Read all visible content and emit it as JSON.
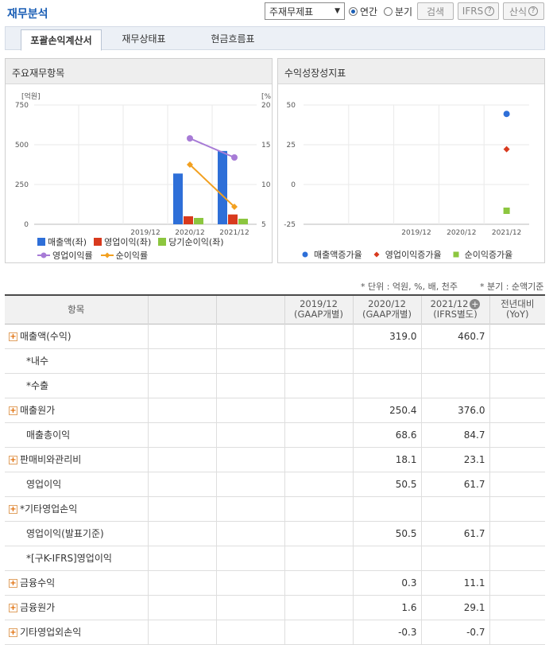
{
  "header": {
    "title": "재무분석",
    "select_value": "주재무제표",
    "radio_annual": "연간",
    "radio_quarter": "분기",
    "search_button": "검색",
    "ifrs_button": "IFRS",
    "formula_button": "산식"
  },
  "tabs": [
    "포괄손익계산서",
    "재무상태표",
    "현금흐름표"
  ],
  "chart_left": {
    "title": "주요재무항목",
    "y_left_unit": "[억원]",
    "y_right_unit": "[%]",
    "y_left_ticks": [
      "750",
      "500",
      "250",
      "0"
    ],
    "y_right_ticks": [
      "20",
      "15",
      "10",
      "5"
    ],
    "legend": {
      "revenue": "매출액(좌)",
      "op_income": "영업이익(좌)",
      "net_income": "당기순이익(좌)",
      "op_margin": "영업이익률",
      "net_margin": "순이익률"
    }
  },
  "chart_right": {
    "title": "수익성장성지표",
    "y_ticks": [
      "50",
      "25",
      "0",
      "-25"
    ],
    "legend": {
      "rev_growth": "매출액증가율",
      "op_growth": "영업이익증가율",
      "net_growth": "순이익증가율"
    }
  },
  "chart_data": [
    {
      "type": "bar",
      "title": "주요재무항목",
      "categories": [
        "2019/12",
        "2020/12",
        "2021/12"
      ],
      "ylim": [
        0,
        750
      ],
      "y2lim": [
        5,
        20
      ],
      "series": [
        {
          "name": "매출액(좌)",
          "values": [
            null,
            319.0,
            460.7
          ],
          "color": "#2e6fd8"
        },
        {
          "name": "영업이익(좌)",
          "values": [
            null,
            50.5,
            61.7
          ],
          "color": "#d83a1e"
        },
        {
          "name": "당기순이익(좌)",
          "values": [
            null,
            40,
            35
          ],
          "color": "#8cc63f"
        },
        {
          "name": "영업이익률",
          "type": "line",
          "axis": "right",
          "values": [
            null,
            15.8,
            13.4
          ],
          "color": "#a77bd6"
        },
        {
          "name": "순이익률",
          "type": "line",
          "axis": "right",
          "values": [
            null,
            12.5,
            7.2
          ],
          "color": "#f2a020"
        }
      ]
    },
    {
      "type": "scatter",
      "title": "수익성장성지표",
      "categories": [
        "2019/12",
        "2020/12",
        "2021/12"
      ],
      "ylim": [
        -25,
        50
      ],
      "series": [
        {
          "name": "매출액증가율",
          "values": [
            null,
            null,
            44.4
          ],
          "color": "#2e6fd8"
        },
        {
          "name": "영업이익증가율",
          "values": [
            null,
            null,
            22.2
          ],
          "color": "#d83a1e"
        },
        {
          "name": "순이익증가율",
          "values": [
            null,
            null,
            -16.5
          ],
          "color": "#8cc63f"
        }
      ]
    }
  ],
  "notes": {
    "unit": "* 단위 : 억원, %, 배, 천주",
    "quarter": "* 분기 : 순액기준"
  },
  "table": {
    "headers": [
      {
        "l1": "항목",
        "l2": ""
      },
      {
        "l1": "",
        "l2": ""
      },
      {
        "l1": "",
        "l2": ""
      },
      {
        "l1": "2019/12",
        "l2": "(GAAP개별)"
      },
      {
        "l1": "2020/12",
        "l2": "(GAAP개별)"
      },
      {
        "l1": "2021/12",
        "l2": "(IFRS별도)"
      },
      {
        "l1": "전년대비",
        "l2": "(YoY)"
      }
    ],
    "rows": [
      {
        "label": "매출액(수익)",
        "expand": true,
        "v2019": "",
        "v2020": "319.0",
        "v2021": "460.7",
        "yoy": ""
      },
      {
        "label": "*내수",
        "expand": false,
        "v2019": "",
        "v2020": "",
        "v2021": "",
        "yoy": ""
      },
      {
        "label": "*수출",
        "expand": false,
        "v2019": "",
        "v2020": "",
        "v2021": "",
        "yoy": ""
      },
      {
        "label": "매출원가",
        "expand": true,
        "v2019": "",
        "v2020": "250.4",
        "v2021": "376.0",
        "yoy": ""
      },
      {
        "label": "매출총이익",
        "expand": false,
        "v2019": "",
        "v2020": "68.6",
        "v2021": "84.7",
        "yoy": ""
      },
      {
        "label": "판매비와관리비",
        "expand": true,
        "v2019": "",
        "v2020": "18.1",
        "v2021": "23.1",
        "yoy": ""
      },
      {
        "label": "영업이익",
        "expand": false,
        "v2019": "",
        "v2020": "50.5",
        "v2021": "61.7",
        "yoy": ""
      },
      {
        "label": "*기타영업손익",
        "expand": true,
        "v2019": "",
        "v2020": "",
        "v2021": "",
        "yoy": ""
      },
      {
        "label": "영업이익(발표기준)",
        "expand": false,
        "v2019": "",
        "v2020": "50.5",
        "v2021": "61.7",
        "yoy": ""
      },
      {
        "label": "*[구K-IFRS]영업이익",
        "expand": false,
        "v2019": "",
        "v2020": "",
        "v2021": "",
        "yoy": ""
      },
      {
        "label": "금융수익",
        "expand": true,
        "v2019": "",
        "v2020": "0.3",
        "v2021": "11.1",
        "yoy": ""
      },
      {
        "label": "금융원가",
        "expand": true,
        "v2019": "",
        "v2020": "1.6",
        "v2021": "29.1",
        "yoy": ""
      },
      {
        "label": "기타영업외손익",
        "expand": true,
        "v2019": "",
        "v2020": "-0.3",
        "v2021": "-0.7",
        "yoy": ""
      }
    ]
  }
}
